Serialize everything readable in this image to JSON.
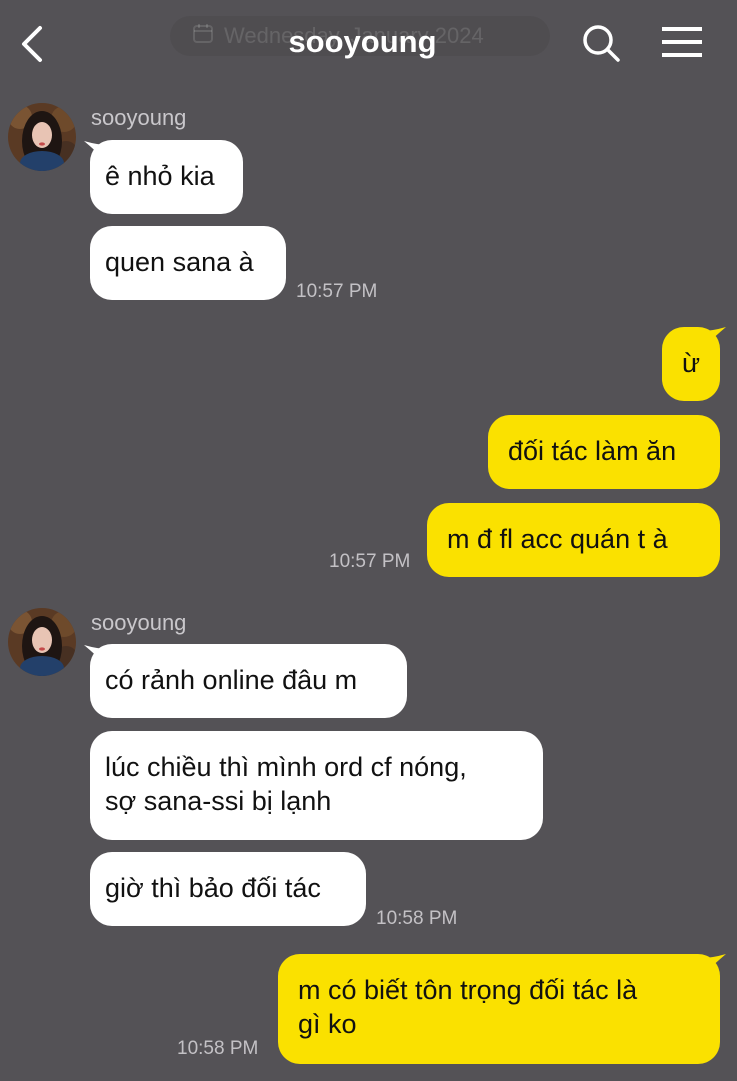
{
  "header": {
    "date": "Wednesday, January 2024",
    "title": "sooyoung"
  },
  "messages": {
    "m1": "ê nhỏ kia",
    "m2": "quen sana à",
    "t1": "10:57 PM",
    "m3": "ừ",
    "m4": "đối tác làm ăn",
    "m5": "m đ fl acc quán t à",
    "t2": "10:57 PM",
    "m6": "có rảnh online đâu m",
    "m7": "lúc chiều thì mình ord cf nóng,\nsợ sana-ssi bị lạnh",
    "m8": "giờ thì bảo đối tác",
    "t3": "10:58 PM",
    "m9": "m có biết tôn trọng đối tác là\ngì ko",
    "t4": "10:58 PM"
  },
  "senders": {
    "group1": "sooyoung",
    "group2": "sooyoung"
  },
  "colors": {
    "background": "#545256",
    "incoming_bubble": "#ffffff",
    "outgoing_bubble": "#fae100",
    "text": "#111111"
  },
  "icons": {
    "back": "chevron-left-icon",
    "search": "search-icon",
    "menu": "hamburger-menu-icon",
    "calendar": "calendar-icon"
  }
}
